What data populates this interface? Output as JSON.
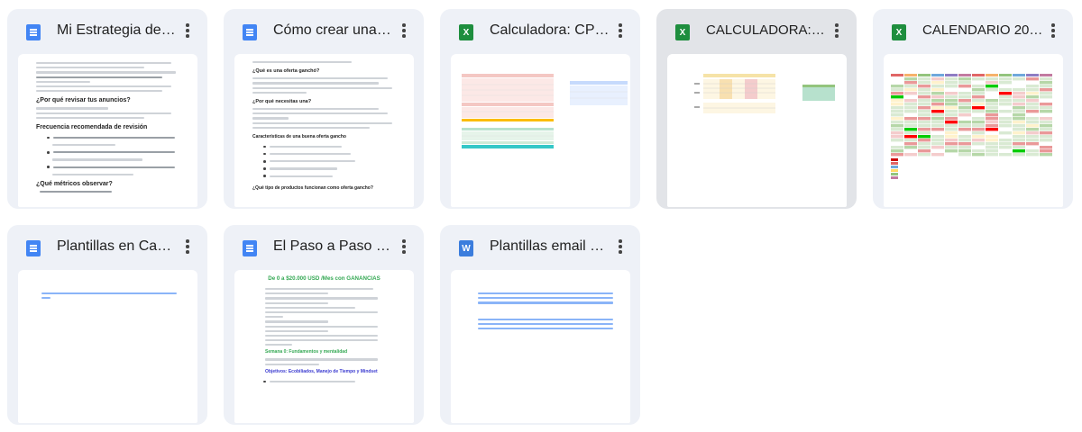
{
  "files": [
    {
      "title": "Mi Estrategia de…",
      "type": "doc",
      "icon": "docs-icon",
      "glyph": ""
    },
    {
      "title": "Cómo crear una …",
      "type": "doc",
      "icon": "docs-icon",
      "glyph": ""
    },
    {
      "title": "Calculadora: CP…",
      "type": "sheet",
      "icon": "sheets-icon",
      "glyph": "X"
    },
    {
      "title": "CALCULADORA:…",
      "type": "sheet",
      "icon": "sheets-icon",
      "glyph": "X"
    },
    {
      "title": "CALENDARIO 20…",
      "type": "sheet",
      "icon": "sheets-icon",
      "glyph": "X"
    },
    {
      "title": "Plantillas en Can…",
      "type": "doc",
      "icon": "docs-icon",
      "glyph": ""
    },
    {
      "title": "El Paso a Paso …",
      "type": "doc",
      "icon": "docs-icon",
      "glyph": ""
    },
    {
      "title": "Plantillas email …",
      "type": "word",
      "icon": "word-icon",
      "glyph": "W"
    }
  ],
  "previews": {
    "estrategia": {
      "h1": "¿Por qué revisar tus anuncios?",
      "h2": "Frecuencia recomendada de revisión",
      "b1": "Revisión rápida diaria (5-10 min):",
      "b2": "Revisión profunda semanal:",
      "b3": "Revisión mensual:",
      "h3": "¿Qué métricos observar?",
      "n1": "1. CTR (%)"
    },
    "crear": {
      "h1": "¿Qué es una oferta ganchó?",
      "h2": "¿Por qué necesitas una?",
      "h3": "Características de una buena oferta gancho",
      "h4": "¿Qué tipo de productos funcionan como oferta gancho?"
    },
    "paso": {
      "title": "De 0 a $20.000 USD /Mes con GANANCIAS",
      "sec": "Semana 0: Fundamentos y mentalidad",
      "obj": "Objetivos: Ecobiliados, Manejo de Tiempo y Mindset"
    }
  },
  "colors": {
    "card_bg": "#eef1f7",
    "card_selected_bg": "#e2e4e8",
    "docs_blue": "#4285f4",
    "sheets_green": "#1e8e3e",
    "word_blue": "#3b7ddd"
  }
}
